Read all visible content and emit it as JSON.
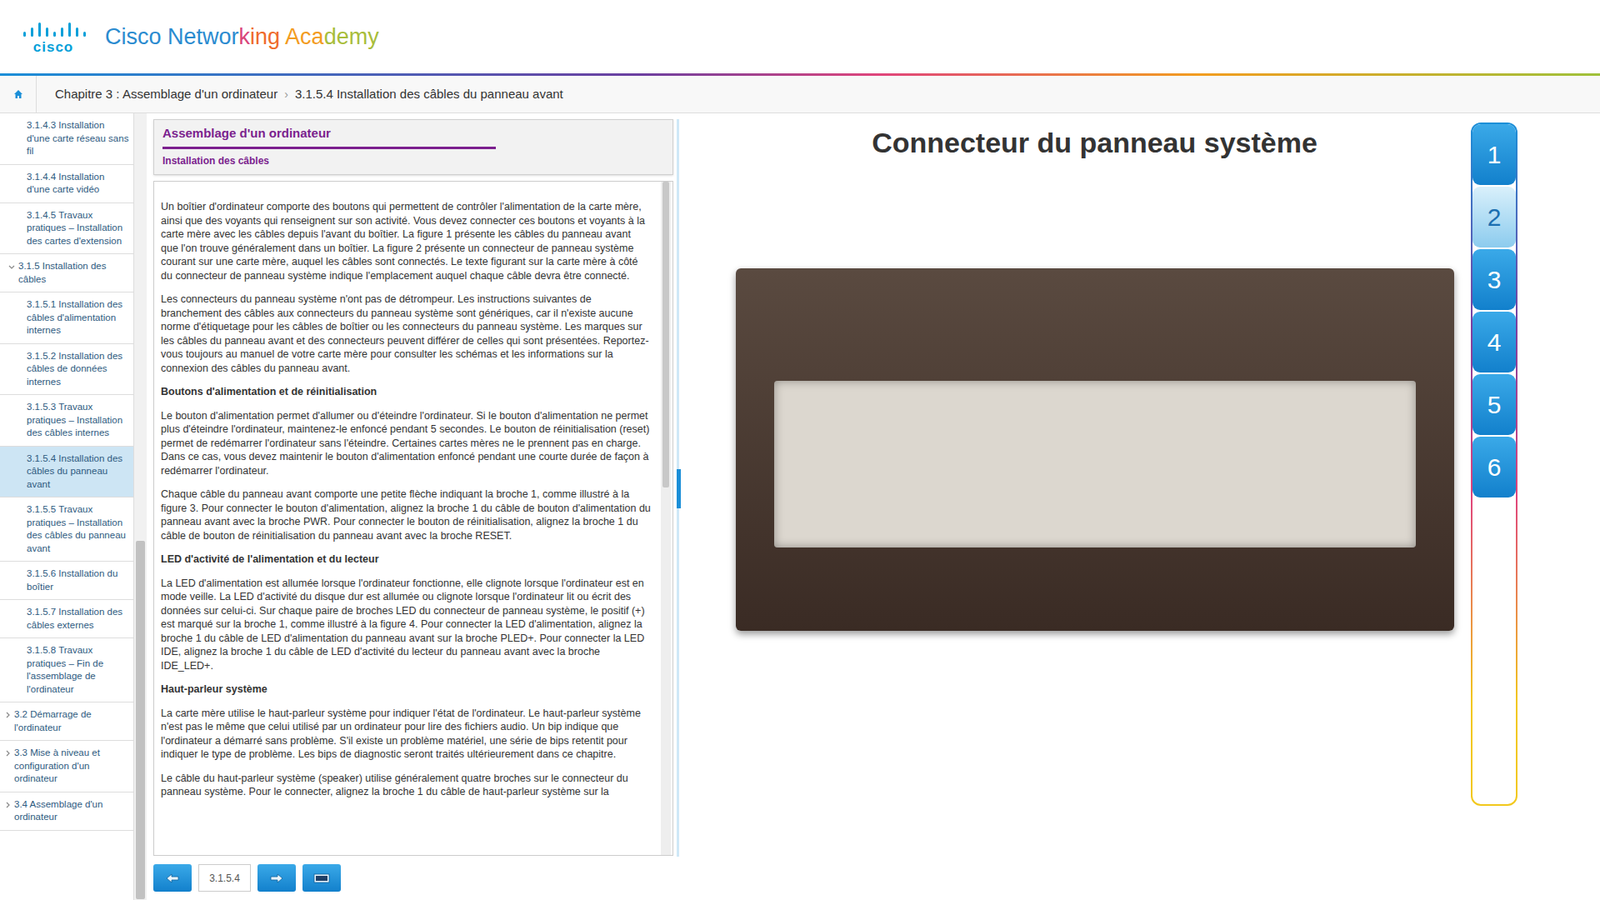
{
  "header": {
    "logo_mark": "cisco",
    "brand": [
      {
        "text": "Cisco Networ",
        "color": "#2a8bd0"
      },
      {
        "text": "k",
        "color": "#d9457a"
      },
      {
        "text": "ing ",
        "color": "#ef6b2b"
      },
      {
        "text": "Aca",
        "color": "#f39c1f"
      },
      {
        "text": "demy",
        "color": "#a8bd3a"
      }
    ]
  },
  "breadcrumb": {
    "separator": "›",
    "items": [
      "Chapitre 3 : Assemblage d'un ordinateur",
      "3.1.5.4 Installation des câbles du panneau avant"
    ]
  },
  "sidebar": {
    "items": [
      {
        "label": "3.1.4.3 Installation d'une carte réseau sans fil",
        "kind": "page",
        "selected": false
      },
      {
        "label": "3.1.4.4 Installation d'une carte vidéo",
        "kind": "page",
        "selected": false
      },
      {
        "label": "3.1.4.5 Travaux pratiques – Installation des cartes d'extension",
        "kind": "page",
        "selected": false
      },
      {
        "label": "3.1.5 Installation des câbles",
        "kind": "section",
        "expanded": true,
        "selected": false
      },
      {
        "label": "3.1.5.1 Installation des câbles d'alimentation internes",
        "kind": "page",
        "selected": false
      },
      {
        "label": "3.1.5.2 Installation des câbles de données internes",
        "kind": "page",
        "selected": false
      },
      {
        "label": "3.1.5.3 Travaux pratiques – Installation des câbles internes",
        "kind": "page",
        "selected": false
      },
      {
        "label": "3.1.5.4 Installation des câbles du panneau avant",
        "kind": "page",
        "selected": true
      },
      {
        "label": "3.1.5.5 Travaux pratiques – Installation des câbles du panneau avant",
        "kind": "page",
        "selected": false
      },
      {
        "label": "3.1.5.6 Installation du boîtier",
        "kind": "page",
        "selected": false
      },
      {
        "label": "3.1.5.7 Installation des câbles externes",
        "kind": "page",
        "selected": false
      },
      {
        "label": "3.1.5.8 Travaux pratiques – Fin de l'assemblage de l'ordinateur",
        "kind": "page",
        "selected": false
      },
      {
        "label": "3.2 Démarrage de l'ordinateur",
        "kind": "chapter",
        "expanded": false,
        "selected": false
      },
      {
        "label": "3.3 Mise à niveau et configuration d'un ordinateur",
        "kind": "chapter",
        "expanded": false,
        "selected": false
      },
      {
        "label": "3.4 Assemblage d'un ordinateur",
        "kind": "chapter",
        "expanded": false,
        "selected": false
      }
    ]
  },
  "content": {
    "title": "Assemblage d'un ordinateur",
    "subtitle": "Installation des câbles",
    "blocks": [
      {
        "kind": "paragraph",
        "text": "Un boîtier d'ordinateur comporte des boutons qui permettent de contrôler l'alimentation de la carte mère, ainsi que des voyants qui renseignent sur son activité. Vous devez connecter ces boutons et voyants à la carte mère avec les câbles depuis l'avant du boîtier. La figure 1 présente les câbles du panneau avant que l'on trouve généralement dans un boîtier. La figure 2 présente un connecteur de panneau système courant sur une carte mère, auquel les câbles sont connectés. Le texte figurant sur la carte mère à côté du connecteur de panneau système indique l'emplacement auquel chaque câble devra être connecté."
      },
      {
        "kind": "paragraph",
        "text": "Les connecteurs du panneau système n'ont pas de détrompeur. Les instructions suivantes de branchement des câbles aux connecteurs du panneau système sont génériques, car il n'existe aucune norme d'étiquetage pour les câbles de boîtier ou les connecteurs du panneau système. Les marques sur les câbles du panneau avant et des connecteurs peuvent différer de celles qui sont présentées. Reportez-vous toujours au manuel de votre carte mère pour consulter les schémas et les informations sur la connexion des câbles du panneau avant."
      },
      {
        "kind": "heading",
        "text": "Boutons d'alimentation et de réinitialisation"
      },
      {
        "kind": "paragraph",
        "text": "Le bouton d'alimentation permet d'allumer ou d'éteindre l'ordinateur. Si le bouton d'alimentation ne permet plus d'éteindre l'ordinateur, maintenez-le enfoncé pendant 5 secondes. Le bouton de réinitialisation (reset) permet de redémarrer l'ordinateur sans l'éteindre. Certaines cartes mères ne le prennent pas en charge. Dans ce cas, vous devez maintenir le bouton d'alimentation enfoncé pendant une courte durée de façon à redémarrer l'ordinateur."
      },
      {
        "kind": "paragraph",
        "text": "Chaque câble du panneau avant comporte une petite flèche indiquant la broche 1, comme illustré à la figure 3. Pour connecter le bouton d'alimentation, alignez la broche 1 du câble de bouton d'alimentation du panneau avant avec la broche PWR. Pour connecter le bouton de réinitialisation, alignez la broche 1 du câble de bouton de réinitialisation du panneau avant avec la broche RESET."
      },
      {
        "kind": "heading",
        "text": "LED d'activité de l'alimentation et du lecteur"
      },
      {
        "kind": "paragraph",
        "text": "La LED d'alimentation est allumée lorsque l'ordinateur fonctionne, elle clignote lorsque l'ordinateur est en mode veille. La LED d'activité du disque dur est allumée ou clignote lorsque l'ordinateur lit ou écrit des données sur celui-ci. Sur chaque paire de broches LED du connecteur de panneau système, le positif (+) est marqué sur la broche 1, comme illustré à la figure 4. Pour connecter la LED d'alimentation, alignez la broche 1 du câble de LED d'alimentation du panneau avant sur la broche PLED+. Pour connecter la LED IDE, alignez la broche 1 du câble de LED d'activité du lecteur du panneau avant avec la broche IDE_LED+."
      },
      {
        "kind": "heading",
        "text": "Haut-parleur système"
      },
      {
        "kind": "paragraph",
        "text": "La carte mère utilise le haut-parleur système pour indiquer l'état de l'ordinateur. Le haut-parleur système n'est pas le même que celui utilisé par un ordinateur pour lire des fichiers audio. Un bip indique que l'ordinateur a démarré sans problème. S'il existe un problème matériel, une série de bips retentit pour indiquer le type de problème. Les bips de diagnostic seront traités ultérieurement dans ce chapitre."
      },
      {
        "kind": "paragraph",
        "text": "Le câble du haut-parleur système (speaker) utilise généralement quatre broches sur le connecteur du panneau système. Pour le connecter, alignez la broche 1 du câble de haut-parleur système sur la"
      }
    ]
  },
  "nav": {
    "page": "3.1.5.4"
  },
  "figure": {
    "title": "Connecteur du panneau système"
  },
  "figure_tabs": [
    {
      "label": "1",
      "selected": false
    },
    {
      "label": "2",
      "selected": true
    },
    {
      "label": "3",
      "selected": false
    },
    {
      "label": "4",
      "selected": false
    },
    {
      "label": "5",
      "selected": false
    },
    {
      "label": "6",
      "selected": false
    }
  ]
}
